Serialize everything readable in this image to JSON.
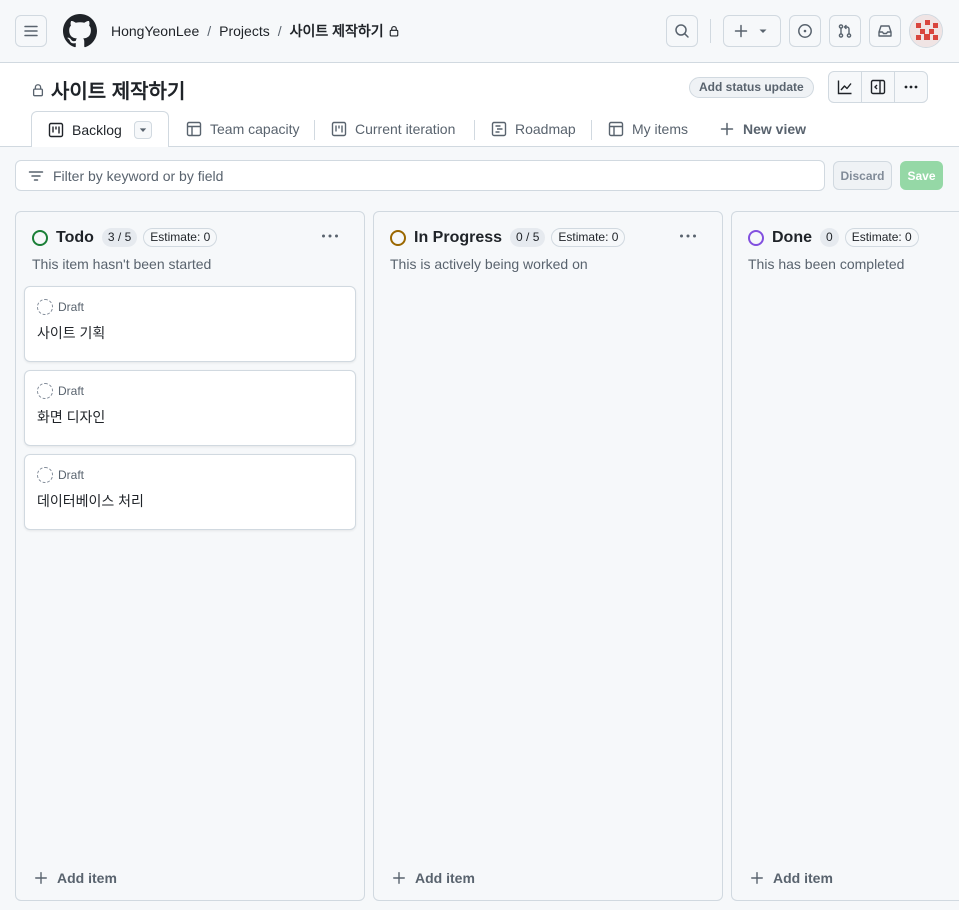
{
  "breadcrumb": {
    "owner": "HongYeonLee",
    "projects": "Projects",
    "project": "사이트 제작하기",
    "separator": "/"
  },
  "project": {
    "title": "사이트 제작하기",
    "status_update_label": "Add status update"
  },
  "views": [
    {
      "label": "Backlog",
      "icon": "board-icon",
      "active": true
    },
    {
      "label": "Team capacity",
      "icon": "table-icon"
    },
    {
      "label": "Current iteration",
      "icon": "board-icon"
    },
    {
      "label": "Roadmap",
      "icon": "roadmap-icon"
    },
    {
      "label": "My items",
      "icon": "table-icon"
    }
  ],
  "new_view_label": "New view",
  "filter": {
    "placeholder": "Filter by keyword or by field",
    "discard_label": "Discard",
    "save_label": "Save"
  },
  "columns": [
    {
      "name": "Todo",
      "count": "3 / 5",
      "estimate": "Estimate: 0",
      "description": "This item hasn't been started",
      "color": "#1a7f37",
      "cards": [
        {
          "type": "Draft",
          "title": "사이트 기획"
        },
        {
          "type": "Draft",
          "title": "화면 디자인"
        },
        {
          "type": "Draft",
          "title": "데이터베이스 처리"
        }
      ],
      "add_label": "Add item"
    },
    {
      "name": "In Progress",
      "count": "0 / 5",
      "estimate": "Estimate: 0",
      "description": "This is actively being worked on",
      "color": "#9a6700",
      "cards": [],
      "add_label": "Add item"
    },
    {
      "name": "Done",
      "count": "0",
      "estimate": "Estimate: 0",
      "description": "This has been completed",
      "color": "#8250df",
      "cards": [],
      "add_label": "Add item"
    }
  ]
}
